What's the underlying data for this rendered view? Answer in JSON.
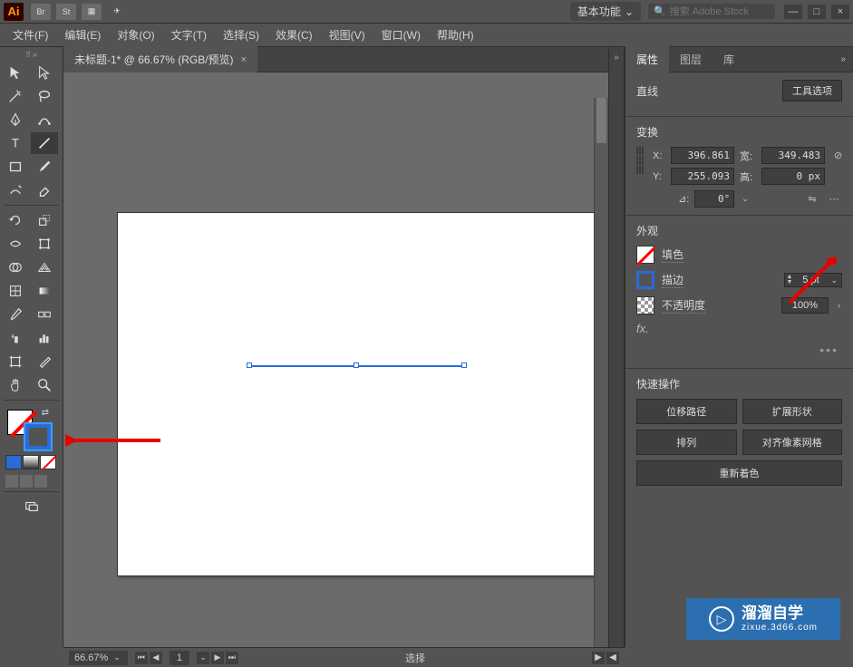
{
  "titlebar": {
    "logo": "Ai",
    "icons": [
      "Br",
      "St"
    ],
    "workspace": "基本功能",
    "search_placeholder": "搜索 Adobe Stock"
  },
  "window_controls": {
    "min": "—",
    "max": "□",
    "close": "×"
  },
  "menu": {
    "file": "文件(F)",
    "edit": "编辑(E)",
    "object": "对象(O)",
    "type": "文字(T)",
    "select": "选择(S)",
    "effect": "效果(C)",
    "view": "视图(V)",
    "window": "窗口(W)",
    "help": "帮助(H)"
  },
  "doc_tab": {
    "title": "未标题-1* @ 66.67% (RGB/预览)",
    "close": "×"
  },
  "panel_tabs": {
    "properties": "属性",
    "layers": "图层",
    "libraries": "库"
  },
  "line_section": {
    "title": "直线",
    "tool_options": "工具选项"
  },
  "transform": {
    "title": "变换",
    "x_label": "X:",
    "y_label": "Y:",
    "w_label": "宽:",
    "h_label": "高:",
    "x": "396.861",
    "y": "255.093",
    "w": "349.483",
    "h": "0 px",
    "angle_label": "⊿:",
    "angle": "0°"
  },
  "appearance": {
    "title": "外观",
    "fill": "填色",
    "stroke": "描边",
    "stroke_weight": "5 pt",
    "opacity_label": "不透明度",
    "opacity": "100%",
    "fx": "fx."
  },
  "quick": {
    "title": "快速操作",
    "offset_path": "位移路径",
    "expand_shape": "扩展形状",
    "arrange": "排列",
    "align_pixel": "对齐像素网格",
    "recolor": "重新着色"
  },
  "status": {
    "zoom": "66.67%",
    "artboard": "1",
    "mode": "选择"
  },
  "watermark": {
    "big": "溜溜自学",
    "small": "zixue.3d66.com"
  },
  "tools": {
    "selection": "selection-tool",
    "direct_selection": "direct-selection-tool",
    "magic_wand": "magic-wand-tool",
    "lasso": "lasso-tool",
    "pen": "pen-tool",
    "curvature": "curvature-tool",
    "type": "type-tool",
    "line": "line-tool",
    "rectangle": "rectangle-tool",
    "paintbrush": "paintbrush-tool",
    "shaper": "shaper-tool",
    "eraser": "eraser-tool",
    "rotate": "rotate-tool",
    "scale": "scale-tool",
    "width": "width-tool",
    "free_transform": "free-transform-tool",
    "shape_builder": "shape-builder-tool",
    "perspective": "perspective-grid-tool",
    "mesh": "mesh-tool",
    "gradient": "gradient-tool",
    "eyedropper": "eyedropper-tool",
    "blend": "blend-tool",
    "symbol_sprayer": "symbol-sprayer-tool",
    "column_graph": "column-graph-tool",
    "artboard": "artboard-tool",
    "slice": "slice-tool",
    "hand": "hand-tool",
    "zoom": "zoom-tool"
  }
}
